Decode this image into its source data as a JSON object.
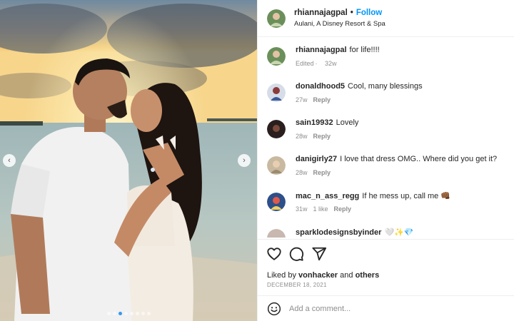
{
  "post": {
    "username": "rhiannajagpal",
    "separator": "•",
    "follow_label": "Follow",
    "location": "Aulani, A Disney Resort & Spa",
    "caption": {
      "username": "rhiannajagpal",
      "text": "for life!!!!",
      "edited": "Edited",
      "age": "32w"
    }
  },
  "media": {
    "prev_icon": "chevron-left-icon",
    "next_icon": "chevron-right-icon",
    "carousel_dots": 8,
    "active_dot_index": 2,
    "colors": {
      "sky": "#8aa7b8",
      "sun": "#f6c25a",
      "sea": "#b9c9c4",
      "shirt": "#f2f2f2",
      "hair": "#1e1410"
    }
  },
  "comments": [
    {
      "username": "donaldhood5",
      "text": "Cool, many blessings",
      "age": "27w",
      "likes": "",
      "reply": "Reply"
    },
    {
      "username": "sain19932",
      "text": "Lovely",
      "age": "28w",
      "likes": "",
      "reply": "Reply"
    },
    {
      "username": "danigirly27",
      "text": "I love that dress OMG.. Where did you get it?",
      "age": "28w",
      "likes": "",
      "reply": "Reply"
    },
    {
      "username": "mac_n_ass_regg",
      "text": "If he mess up, call me 👊🏾",
      "age": "31w",
      "likes": "1 like",
      "reply": "Reply"
    },
    {
      "username": "sparklodesignsbyinder",
      "text": "🤍✨💎",
      "age": "",
      "likes": "",
      "reply": ""
    }
  ],
  "actions": {
    "like_icon": "heart-icon",
    "comment_icon": "comment-icon",
    "share_icon": "share-icon"
  },
  "likes": {
    "prefix": "Liked by",
    "user": "vonhacker",
    "and": "and",
    "others": "others"
  },
  "date": "DECEMBER 18, 2021",
  "add_comment": {
    "placeholder": "Add a comment...",
    "emoji_icon": "emoji-icon"
  },
  "avatar_colors": [
    "#6b8f5a",
    "#a3b8d8",
    "#3a2a2a",
    "#c9b9a0",
    "#2d4f8a",
    "#c8b8b0"
  ]
}
